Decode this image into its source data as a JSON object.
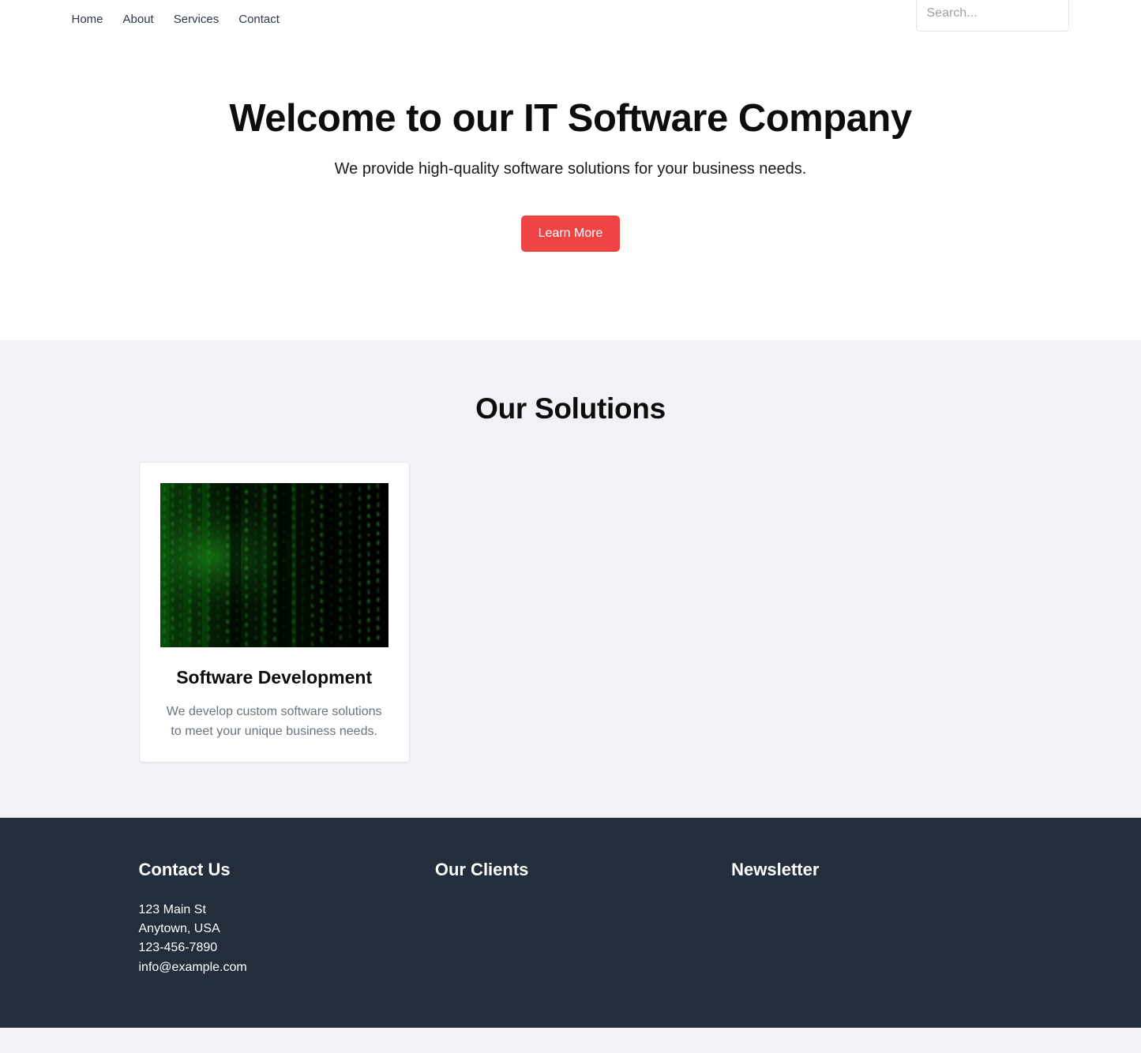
{
  "nav": {
    "links": [
      {
        "label": "Home"
      },
      {
        "label": "About"
      },
      {
        "label": "Services"
      },
      {
        "label": "Contact"
      }
    ],
    "search": {
      "placeholder": "Search...",
      "value": ""
    }
  },
  "hero": {
    "title": "Welcome to our IT Software Company",
    "subtitle": "We provide high-quality software solutions for your business needs.",
    "cta_label": "Learn More",
    "cta_color": "#ef4444"
  },
  "solutions": {
    "title": "Our Solutions",
    "cards": [
      {
        "image_alt": "matrix-code-rain-image",
        "title": "Software Development",
        "description": "We develop custom software solutions to meet your unique business needs."
      }
    ]
  },
  "footer": {
    "background": "#242d3c",
    "columns": [
      {
        "heading": "Contact Us",
        "lines": [
          "123 Main St",
          "Anytown, USA",
          "123-456-7890",
          "info@example.com"
        ]
      },
      {
        "heading": "Our Clients",
        "lines": []
      },
      {
        "heading": "Newsletter",
        "lines": []
      }
    ]
  }
}
